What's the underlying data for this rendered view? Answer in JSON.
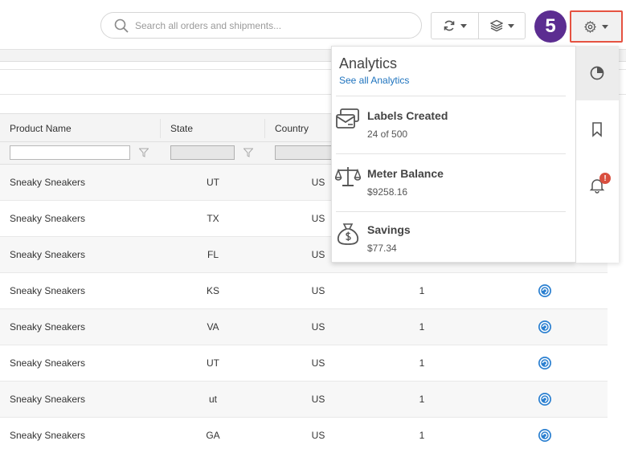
{
  "search": {
    "placeholder": "Search all orders and shipments..."
  },
  "toolbar": {
    "refresh_icon": "refresh-icon",
    "layers_icon": "layers-icon",
    "settings_icon": "gear-icon"
  },
  "step_badge": "5",
  "table": {
    "columns": [
      "Product Name",
      "State",
      "Country"
    ],
    "rows": [
      {
        "product": "Sneaky Sneakers",
        "state": "UT",
        "country": "US",
        "qty": ""
      },
      {
        "product": "Sneaky Sneakers",
        "state": "TX",
        "country": "US",
        "qty": ""
      },
      {
        "product": "Sneaky Sneakers",
        "state": "FL",
        "country": "US",
        "qty": ""
      },
      {
        "product": "Sneaky Sneakers",
        "state": "KS",
        "country": "US",
        "qty": "1"
      },
      {
        "product": "Sneaky Sneakers",
        "state": "VA",
        "country": "US",
        "qty": "1"
      },
      {
        "product": "Sneaky Sneakers",
        "state": "UT",
        "country": "US",
        "qty": "1"
      },
      {
        "product": "Sneaky Sneakers",
        "state": "ut",
        "country": "US",
        "qty": "1"
      },
      {
        "product": "Sneaky Sneakers",
        "state": "GA",
        "country": "US",
        "qty": "1"
      }
    ]
  },
  "analytics": {
    "title": "Analytics",
    "link": "See all Analytics",
    "metrics": [
      {
        "label": "Labels Created",
        "value": "24 of 500",
        "icon": "labels-icon"
      },
      {
        "label": "Meter Balance",
        "value": "$9258.16",
        "icon": "scale-icon"
      },
      {
        "label": "Savings",
        "value": "$77.34",
        "icon": "money-bag-icon"
      }
    ]
  },
  "side_panel": {
    "notification_badge": "!"
  },
  "colors": {
    "accent": "#1e73be",
    "step_badge": "#5c2d91",
    "highlight_border": "#e55241",
    "alert": "#d94f3f"
  }
}
